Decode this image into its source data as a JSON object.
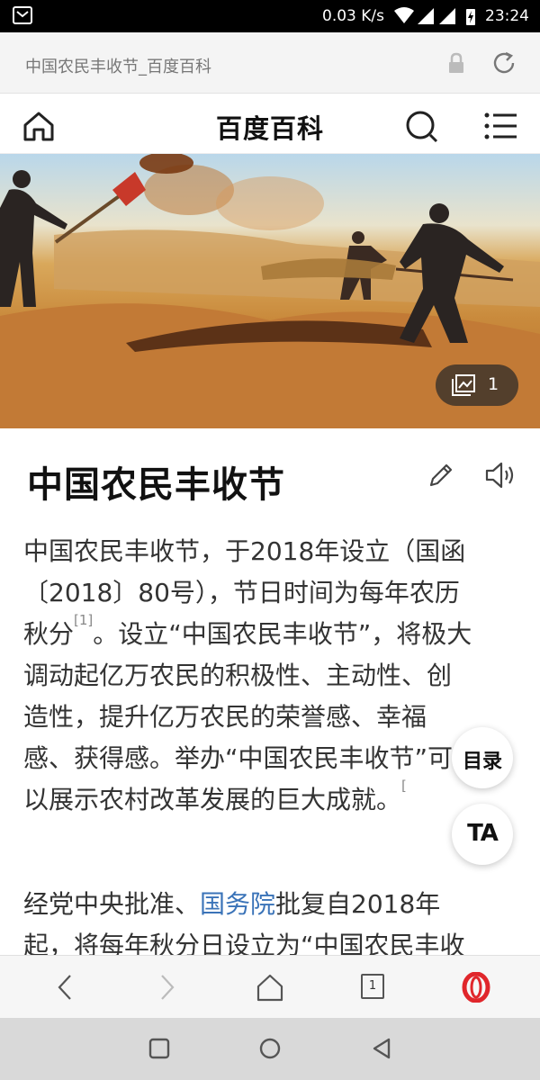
{
  "status_bar": {
    "speed": "0.03 K/s",
    "time": "23:24",
    "icons": [
      "notification-icon",
      "wifi-icon",
      "signal-icon",
      "signal-icon",
      "charging-icon"
    ]
  },
  "address_bar": {
    "url_text": "中国农民丰收节_百度百科",
    "icons": [
      "lock-icon",
      "reload-icon"
    ]
  },
  "site_header": {
    "title": "百度百科",
    "icons": [
      "home-icon",
      "search-icon",
      "menu-icon"
    ]
  },
  "hero": {
    "image_count": "1"
  },
  "article": {
    "title": "中国农民丰收节",
    "paragraph1_lines": [
      "中国农民丰收节，于2018年设立（国函",
      "〔2018〕80号），节日时间为每年农历",
      "秋分",
      "。设立“中国农民丰收节”，将极大",
      "调动起亿万农民的积极性、主动性、创",
      "造性，提升亿万农民的荣誉感、幸福",
      "感、获得感。举办“中国农民丰收节”可",
      "以展示农村改革发展的巨大成就。"
    ],
    "ref1": "[1]",
    "ref2": "[",
    "paragraph2_line1_before": "经党中央批准、",
    "paragraph2_link": "国务院",
    "paragraph2_line1_after": "批复自2018年",
    "paragraph2_line2": "起，将每年秋分日设立为“中国农民丰收"
  },
  "floating": {
    "toc_label": "目录",
    "ta_label": "TA"
  },
  "toolbar": {
    "tab_count": "1",
    "icons": [
      "back-icon",
      "forward-icon",
      "home-icon",
      "tabs-icon",
      "opera-icon"
    ]
  },
  "colors": {
    "link": "#3a73b8",
    "opera_red": "#e0262b"
  }
}
